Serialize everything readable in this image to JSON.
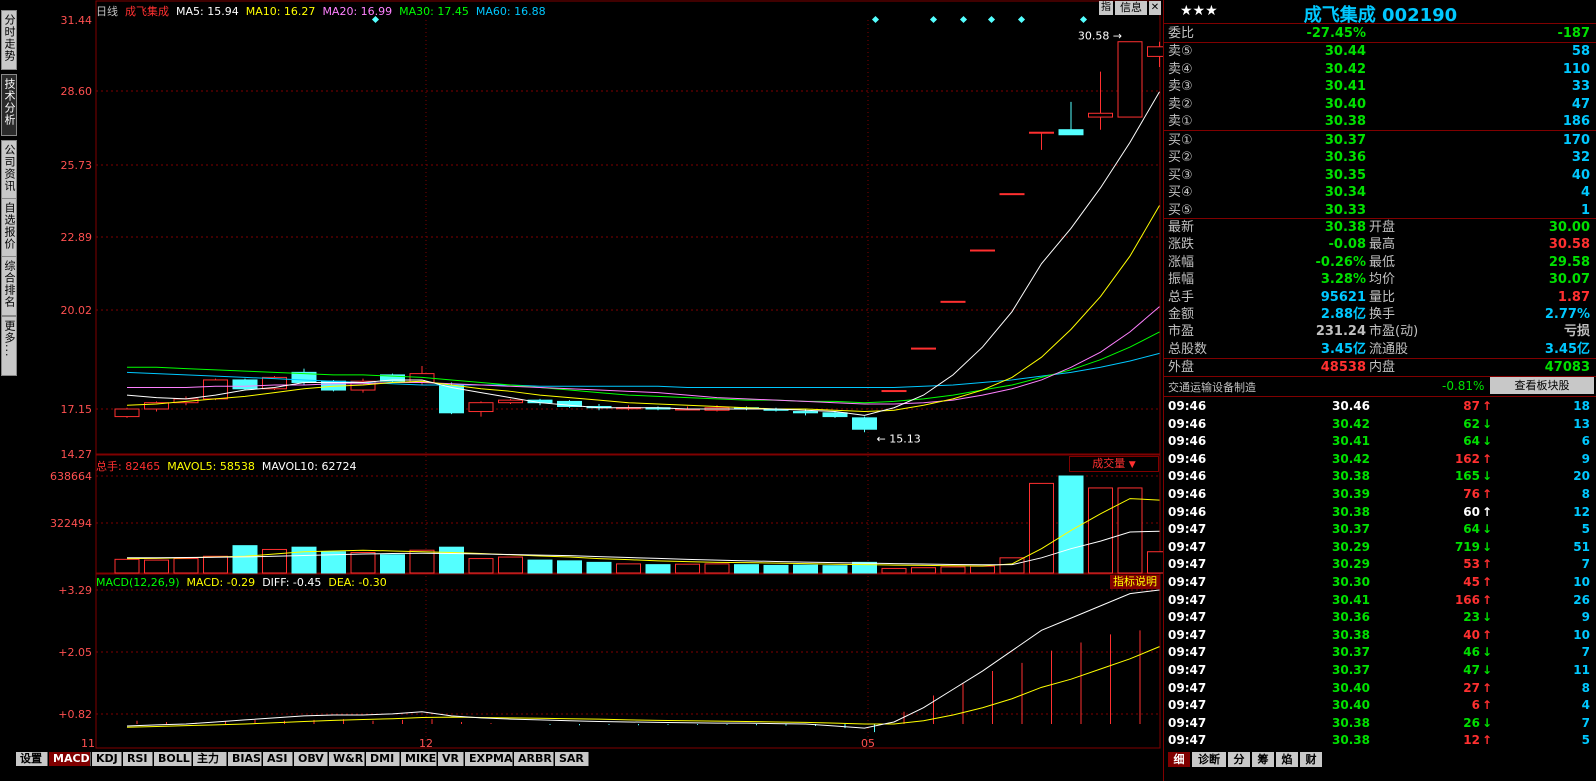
{
  "left_tabs": [
    "分时走势",
    "技术分析",
    "公司资讯",
    "自选报价",
    "综合排名",
    "更多..."
  ],
  "chart": {
    "period": "日线",
    "stock_name": "成飞集成",
    "ma5": "MA5: 15.94",
    "ma10": "MA10: 16.27",
    "ma20": "MA20: 16.99",
    "ma30": "MA30: 17.45",
    "ma60": "MA60: 16.88",
    "btn_info": "信息",
    "btn_zhi": "指",
    "price_ticks": [
      "31.44",
      "28.60",
      "25.73",
      "22.89",
      "20.02",
      "17.15",
      "14.27"
    ],
    "high_label": "30.58",
    "low_label": "15.13",
    "vol_total": "总手: 82465",
    "mavol5": "MAVOL5: 58538",
    "mavol10": "MAVOL10: 62724",
    "vol_select": "成交量",
    "vol_ticks": [
      "638664",
      "322494"
    ],
    "macd_params": "MACD(12,26,9)",
    "macd": "MACD: -0.29",
    "diff": "DIFF: -0.45",
    "dea": "DEA: -0.30",
    "macd_help": "指标说明",
    "macd_ticks": [
      "+3.29",
      "+2.05",
      "+0.82"
    ],
    "x_labels": [
      "11",
      "12",
      "05"
    ]
  },
  "colors": {
    "up": "#ff3030",
    "down": "#54ffff",
    "grid": "#800000",
    "ma5": "#ffffff",
    "ma10": "#ffff00",
    "ma20": "#ff80ff",
    "ma30": "#00ff00",
    "ma60": "#00c8ff"
  },
  "bottom_tabs": [
    "设置",
    "MACD",
    "KDJ",
    "RSI",
    "BOLL",
    "主力",
    "BIAS",
    "ASI",
    "OBV",
    "W&R",
    "DMI",
    "MIKE",
    "VR",
    "EXPMA",
    "ARBR",
    "SAR"
  ],
  "quote": {
    "stars": "★★★",
    "title": "成飞集成 002190",
    "weibi_label": "委比",
    "weibi_val": "-27.45%",
    "weibi_diff": "-187",
    "asks": [
      {
        "l": "卖⑤",
        "p": "30.44",
        "v": "58"
      },
      {
        "l": "卖④",
        "p": "30.42",
        "v": "110"
      },
      {
        "l": "卖③",
        "p": "30.41",
        "v": "33"
      },
      {
        "l": "卖②",
        "p": "30.40",
        "v": "47"
      },
      {
        "l": "卖①",
        "p": "30.38",
        "v": "186"
      }
    ],
    "bids": [
      {
        "l": "买①",
        "p": "30.37",
        "v": "170"
      },
      {
        "l": "买②",
        "p": "30.36",
        "v": "32"
      },
      {
        "l": "买③",
        "p": "30.35",
        "v": "40"
      },
      {
        "l": "买④",
        "p": "30.34",
        "v": "4"
      },
      {
        "l": "买⑤",
        "p": "30.33",
        "v": "1"
      }
    ],
    "stats": [
      {
        "l1": "最新",
        "v1": "30.38",
        "c1": "green",
        "l2": "开盘",
        "v2": "30.00",
        "c2": "green"
      },
      {
        "l1": "涨跌",
        "v1": "-0.08",
        "c1": "green",
        "l2": "最高",
        "v2": "30.58",
        "c2": "red"
      },
      {
        "l1": "涨幅",
        "v1": "-0.26%",
        "c1": "green",
        "l2": "最低",
        "v2": "29.58",
        "c2": "green"
      },
      {
        "l1": "振幅",
        "v1": "3.28%",
        "c1": "green",
        "l2": "均价",
        "v2": "30.07",
        "c2": "green"
      },
      {
        "l1": "总手",
        "v1": "95621",
        "c1": "cyan",
        "l2": "量比",
        "v2": "1.87",
        "c2": "red"
      },
      {
        "l1": "金额",
        "v1": "2.88亿",
        "c1": "cyan",
        "l2": "换手",
        "v2": "2.77%",
        "c2": "cyan"
      },
      {
        "l1": "市盈",
        "v1": "231.24",
        "c1": "gray",
        "l2": "市盈(动)",
        "v2": "亏损",
        "c2": "gray"
      },
      {
        "l1": "总股数",
        "v1": "3.45亿",
        "c1": "cyan",
        "l2": "流通股",
        "v2": "3.45亿",
        "c2": "cyan"
      }
    ],
    "waipan_label": "外盘",
    "waipan": "48538",
    "neipan_label": "内盘",
    "neipan": "47083",
    "sector": "交通运输设备制造",
    "sector_chg": "-0.81%",
    "sector_btn": "查看板块股"
  },
  "ticks": [
    {
      "t": "09:46",
      "p": "30.46",
      "pc": "white",
      "v": "87",
      "d": "up",
      "n": "18"
    },
    {
      "t": "09:46",
      "p": "30.42",
      "pc": "green",
      "v": "62",
      "d": "down",
      "n": "13"
    },
    {
      "t": "09:46",
      "p": "30.41",
      "pc": "green",
      "v": "64",
      "d": "down",
      "n": "6"
    },
    {
      "t": "09:46",
      "p": "30.42",
      "pc": "green",
      "v": "162",
      "d": "up",
      "n": "9"
    },
    {
      "t": "09:46",
      "p": "30.38",
      "pc": "green",
      "v": "165",
      "d": "down",
      "n": "20"
    },
    {
      "t": "09:46",
      "p": "30.39",
      "pc": "green",
      "v": "76",
      "d": "up",
      "n": "8"
    },
    {
      "t": "09:46",
      "p": "30.38",
      "pc": "green",
      "v": "60",
      "d": "flat",
      "n": "12"
    },
    {
      "t": "09:47",
      "p": "30.37",
      "pc": "green",
      "v": "64",
      "d": "down",
      "n": "5"
    },
    {
      "t": "09:47",
      "p": "30.29",
      "pc": "green",
      "v": "719",
      "d": "down",
      "n": "51"
    },
    {
      "t": "09:47",
      "p": "30.29",
      "pc": "green",
      "v": "53",
      "d": "up",
      "n": "7"
    },
    {
      "t": "09:47",
      "p": "30.30",
      "pc": "green",
      "v": "45",
      "d": "up",
      "n": "10"
    },
    {
      "t": "09:47",
      "p": "30.41",
      "pc": "green",
      "v": "166",
      "d": "up",
      "n": "26"
    },
    {
      "t": "09:47",
      "p": "30.36",
      "pc": "green",
      "v": "23",
      "d": "down",
      "n": "9"
    },
    {
      "t": "09:47",
      "p": "30.38",
      "pc": "green",
      "v": "40",
      "d": "up",
      "n": "10"
    },
    {
      "t": "09:47",
      "p": "30.37",
      "pc": "green",
      "v": "46",
      "d": "down",
      "n": "7"
    },
    {
      "t": "09:47",
      "p": "30.37",
      "pc": "green",
      "v": "47",
      "d": "down",
      "n": "11"
    },
    {
      "t": "09:47",
      "p": "30.40",
      "pc": "green",
      "v": "27",
      "d": "up",
      "n": "8"
    },
    {
      "t": "09:47",
      "p": "30.40",
      "pc": "green",
      "v": "6",
      "d": "up",
      "n": "4"
    },
    {
      "t": "09:47",
      "p": "30.38",
      "pc": "green",
      "v": "26",
      "d": "down",
      "n": "7"
    },
    {
      "t": "09:47",
      "p": "30.38",
      "pc": "green",
      "v": "12",
      "d": "up",
      "n": "5"
    }
  ],
  "right_tabs": [
    "细",
    "诊断",
    "分",
    "筹",
    "焰",
    "财"
  ]
}
